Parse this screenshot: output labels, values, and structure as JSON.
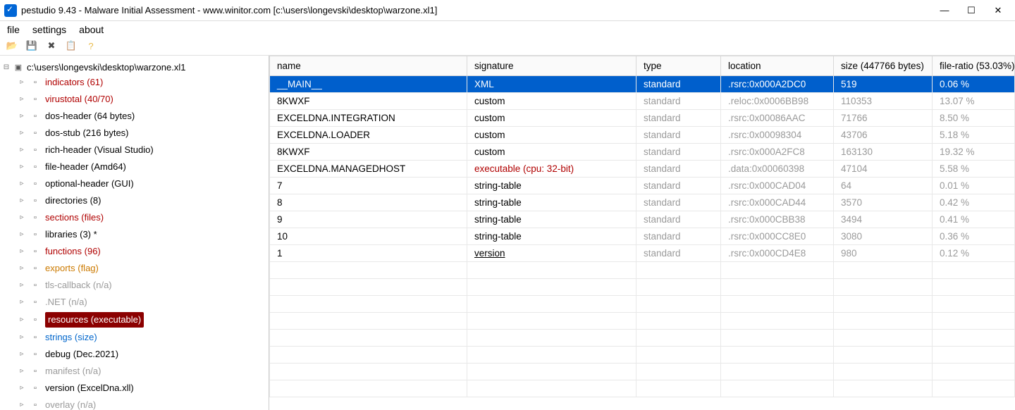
{
  "titlebar": {
    "title": "pestudio 9.43 - Malware Initial Assessment - www.winitor.com [c:\\users\\longevski\\desktop\\warzone.xl1]"
  },
  "menu": {
    "file": "file",
    "settings": "settings",
    "about": "about"
  },
  "tree": {
    "root": "c:\\users\\longevski\\desktop\\warzone.xl1",
    "items": [
      {
        "label": "indicators (61)",
        "cls": "red"
      },
      {
        "label": "virustotal (40/70)",
        "cls": "red"
      },
      {
        "label": "dos-header (64 bytes)",
        "cls": ""
      },
      {
        "label": "dos-stub (216 bytes)",
        "cls": ""
      },
      {
        "label": "rich-header (Visual Studio)",
        "cls": ""
      },
      {
        "label": "file-header (Amd64)",
        "cls": ""
      },
      {
        "label": "optional-header (GUI)",
        "cls": ""
      },
      {
        "label": "directories (8)",
        "cls": ""
      },
      {
        "label": "sections (files)",
        "cls": "red"
      },
      {
        "label": "libraries (3) *",
        "cls": ""
      },
      {
        "label": "functions (96)",
        "cls": "red"
      },
      {
        "label": "exports (flag)",
        "cls": "orange"
      },
      {
        "label": "tls-callback (n/a)",
        "cls": "grey"
      },
      {
        "label": ".NET (n/a)",
        "cls": "grey"
      },
      {
        "label": "resources (executable)",
        "cls": "red",
        "selected": true
      },
      {
        "label": "strings (size)",
        "cls": "blue"
      },
      {
        "label": "debug (Dec.2021)",
        "cls": ""
      },
      {
        "label": "manifest (n/a)",
        "cls": "grey"
      },
      {
        "label": "version (ExcelDna.xll)",
        "cls": ""
      },
      {
        "label": "overlay (n/a)",
        "cls": "grey"
      }
    ]
  },
  "columns": {
    "c0": "name",
    "c1": "signature",
    "c2": "type",
    "c3": "location",
    "c4": "size (447766 bytes)",
    "c5": "file-ratio  (53.03%)"
  },
  "rows": [
    {
      "name": "__MAIN__",
      "sig": "XML",
      "type": "standard",
      "loc": ".rsrc:0x000A2DC0",
      "size": "519",
      "ratio": "0.06 %",
      "sel": true
    },
    {
      "name": "8KWXF",
      "sig": "custom",
      "type": "standard",
      "loc": ".reloc:0x0006BB98",
      "size": "110353",
      "ratio": "13.07 %",
      "grey": true
    },
    {
      "name": "EXCELDNA.INTEGRATION",
      "sig": "custom",
      "type": "standard",
      "loc": ".rsrc:0x00086AAC",
      "size": "71766",
      "ratio": "8.50 %",
      "grey": true
    },
    {
      "name": "EXCELDNA.LOADER",
      "sig": "custom",
      "type": "standard",
      "loc": ".rsrc:0x00098304",
      "size": "43706",
      "ratio": "5.18 %",
      "grey": true
    },
    {
      "name": "8KWXF",
      "sig": "custom",
      "type": "standard",
      "loc": ".rsrc:0x000A2FC8",
      "size": "163130",
      "ratio": "19.32 %",
      "grey": true
    },
    {
      "name": "EXCELDNA.MANAGEDHOST",
      "sig": "executable (cpu: 32-bit)",
      "sigcls": "red",
      "type": "standard",
      "loc": ".data:0x00060398",
      "size": "47104",
      "ratio": "5.58 %",
      "grey": true
    },
    {
      "name": "7",
      "sig": "string-table",
      "type": "standard",
      "loc": ".rsrc:0x000CAD04",
      "size": "64",
      "ratio": "0.01 %",
      "grey": true
    },
    {
      "name": "8",
      "sig": "string-table",
      "type": "standard",
      "loc": ".rsrc:0x000CAD44",
      "size": "3570",
      "ratio": "0.42 %",
      "grey": true
    },
    {
      "name": "9",
      "sig": "string-table",
      "type": "standard",
      "loc": ".rsrc:0x000CBB38",
      "size": "3494",
      "ratio": "0.41 %",
      "grey": true
    },
    {
      "name": "10",
      "sig": "string-table",
      "type": "standard",
      "loc": ".rsrc:0x000CC8E0",
      "size": "3080",
      "ratio": "0.36 %",
      "grey": true
    },
    {
      "name": "1",
      "sig": "version",
      "sigcls": "underline",
      "type": "standard",
      "loc": ".rsrc:0x000CD4E8",
      "size": "980",
      "ratio": "0.12 %",
      "grey": true
    }
  ]
}
